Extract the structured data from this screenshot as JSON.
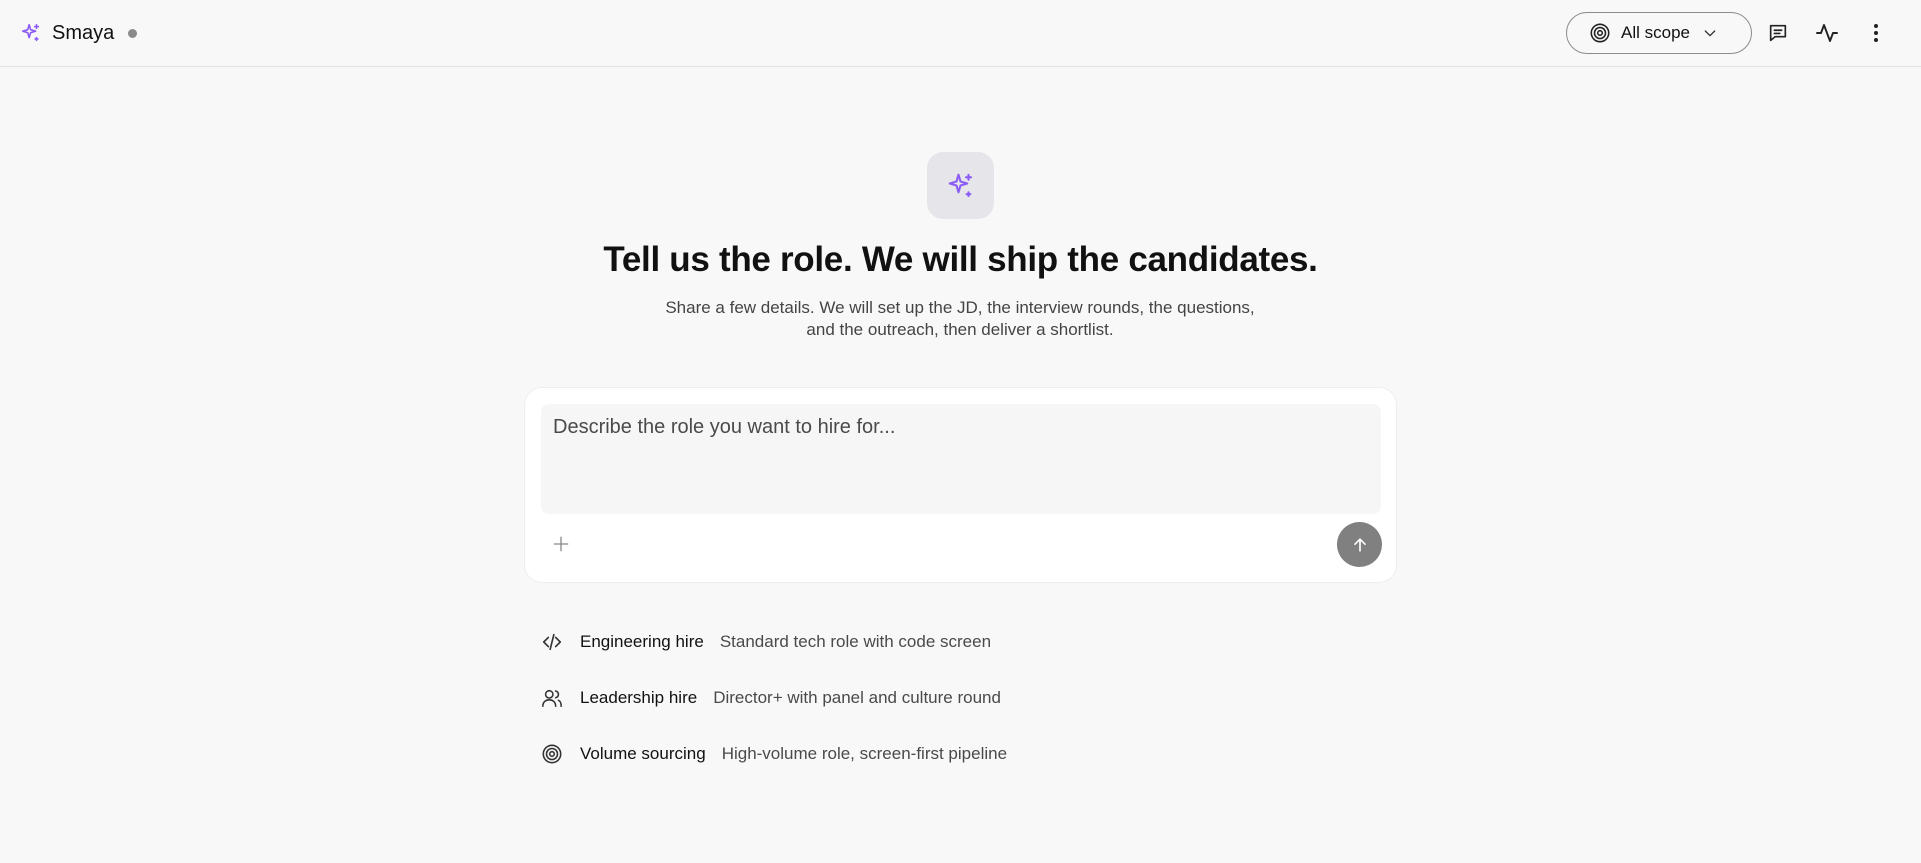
{
  "app": {
    "name": "Smaya",
    "brand_icon": "sparkles-icon",
    "status_dot_color": "#8a8a8a",
    "accent_color": "#8b5cf6"
  },
  "header": {
    "scope_selector": {
      "label": "All scope",
      "icon": "target-icon",
      "chevron": "chevron-down-icon"
    },
    "actions": [
      {
        "icon": "chat-icon"
      },
      {
        "icon": "activity-icon"
      },
      {
        "icon": "more-vertical-icon"
      }
    ]
  },
  "hero": {
    "icon": "sparkles-icon",
    "title": "Tell us the role. We will ship the candidates.",
    "subtitle": "Share a few details. We will set up the JD, the interview rounds, the questions, and the outreach, then deliver a shortlist."
  },
  "composer": {
    "placeholder": "Describe the role you want to hire for...",
    "value": "",
    "add_icon": "plus-icon",
    "send_icon": "arrow-up-icon"
  },
  "suggestions": [
    {
      "icon": "code-icon",
      "title": "Engineering hire",
      "description": "Standard tech role with code screen"
    },
    {
      "icon": "users-icon",
      "title": "Leadership hire",
      "description": "Director+ with panel and culture round"
    },
    {
      "icon": "target-icon",
      "title": "Volume sourcing",
      "description": "High-volume role, screen-first pipeline"
    }
  ]
}
